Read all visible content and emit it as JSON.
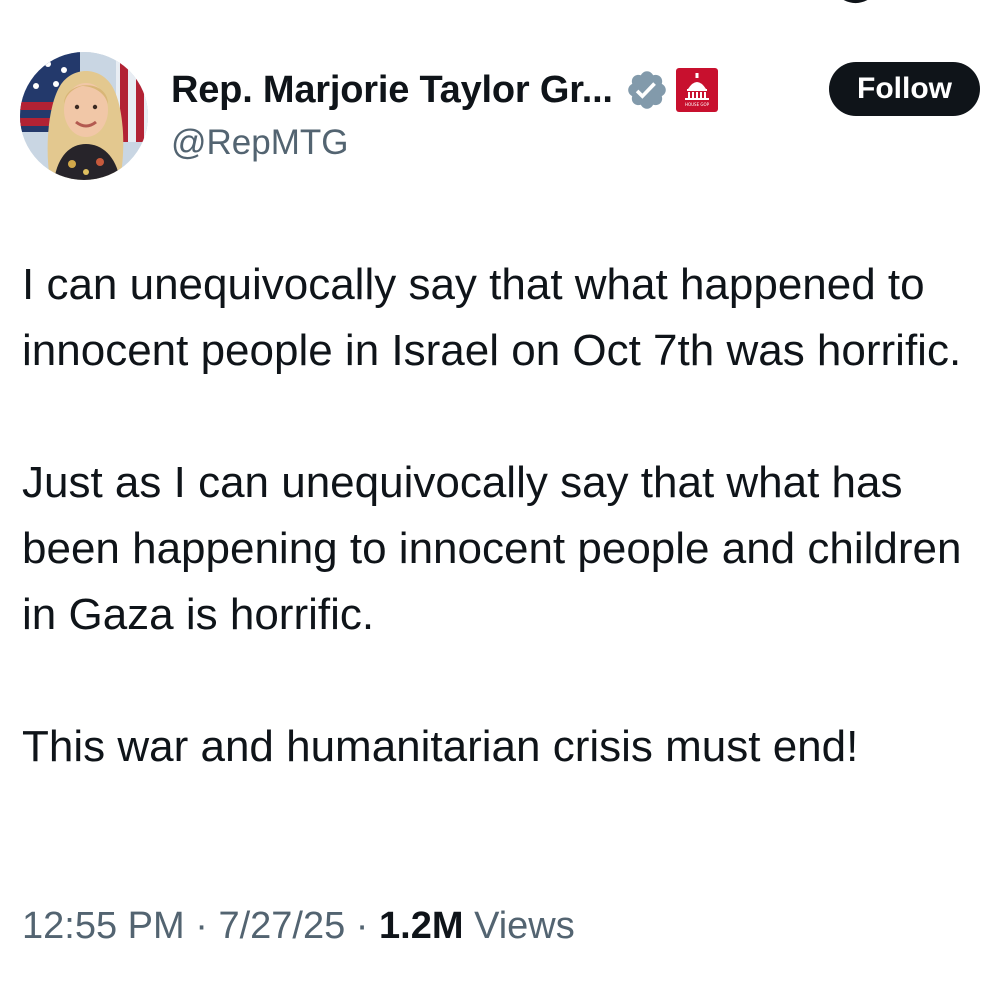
{
  "header": {
    "display_name": "Rep. Marjorie Taylor Gr...",
    "handle": "@RepMTG",
    "follow_label": "Follow",
    "badge_icon": "verified-badge-icon",
    "affiliation_icon": "house-gop-icon",
    "affiliation_badge_text": "HOUSE GOP"
  },
  "tweet": {
    "paragraphs": [
      "I can unequivocally say that what happened to innocent people in Israel on Oct 7th was horrific.",
      "Just as I can unequivocally say that what has been happening to innocent people and children in Gaza is horrific.",
      "This war and humanitarian crisis must end!"
    ],
    "time": "12:55 PM",
    "separator": "·",
    "date": "7/27/25",
    "views_count": "1.2M",
    "views_label": "Views"
  },
  "colors": {
    "text_primary": "#0f1419",
    "text_secondary": "#536471",
    "verified_badge": "#829aab",
    "affiliation_red": "#c8102e",
    "follow_bg": "#0f1419"
  }
}
